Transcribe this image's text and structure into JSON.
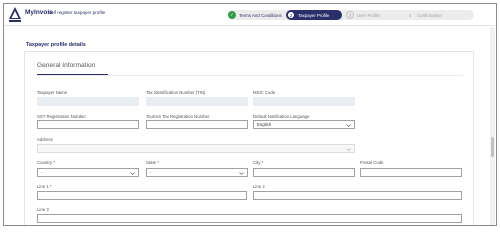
{
  "app": {
    "name": "MyInvois",
    "subtitle": "Self register taxpayer profile"
  },
  "stepper": {
    "steps": [
      {
        "num": "✓",
        "label": "Terms And Conditions"
      },
      {
        "num": "2",
        "label": "Taxpayer Profile"
      },
      {
        "num": "3",
        "label": "User Profile"
      },
      {
        "num": "4",
        "label": "Confirmation"
      }
    ]
  },
  "page": {
    "title": "Taxpayer profile details"
  },
  "section": {
    "title": "General Information"
  },
  "form": {
    "taxpayer_name": {
      "label": "Taxpayer Name",
      "value": ""
    },
    "tin": {
      "label": "Tax Identification Number (TIN)",
      "value": ""
    },
    "msic": {
      "label": "MSIC Code",
      "value": ""
    },
    "sst": {
      "label": "SST Registration Number",
      "value": ""
    },
    "tourism": {
      "label": "Tourism Tax Registration Number",
      "value": ""
    },
    "notification_language": {
      "label": "Default Notification Language",
      "value": "English"
    },
    "address": {
      "label": "Address",
      "value": ""
    },
    "country": {
      "label": "Country *",
      "value": "-"
    },
    "state": {
      "label": "State *",
      "value": "-"
    },
    "city": {
      "label": "City *",
      "value": ""
    },
    "postal_code": {
      "label": "Postal Code",
      "value": ""
    },
    "line1": {
      "label": "Line 1 *",
      "value": ""
    },
    "line2": {
      "label": "Line 2",
      "value": ""
    },
    "line3": {
      "label": "Line 3",
      "value": ""
    }
  },
  "icons": {
    "logo": "lhdn-logo",
    "check": "check-icon",
    "chevron": "chevron-down-icon"
  },
  "colors": {
    "brand": "#2a2f6b",
    "success": "#2e9e48",
    "stepper_bg": "#ececec",
    "filled_field": "#e8ecf3"
  }
}
